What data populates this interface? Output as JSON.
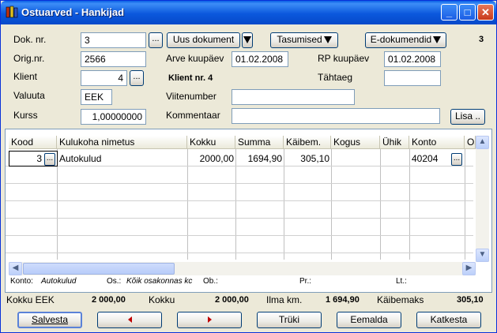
{
  "window": {
    "title": "Ostuarved - Hankijad",
    "buttons": {
      "minimize": "_",
      "maximize": "□",
      "close": "✕"
    }
  },
  "form": {
    "dok_nr_label": "Dok. nr.",
    "dok_nr_value": "3",
    "uus_dokument_label": "Uus dokument",
    "tasumised_label": "Tasumised",
    "edokumendid_label": "E-dokumendid",
    "record_count": "3",
    "orig_nr_label": "Orig.nr.",
    "orig_nr_value": "2566",
    "arve_kuupaev_label": "Arve kuupäev",
    "arve_kuupaev_value": "01.02.2008",
    "rp_kuupaev_label": "RP kuupäev",
    "rp_kuupaev_value": "01.02.2008",
    "klient_label": "Klient",
    "klient_value": "4",
    "klient_name": "Klient nr. 4",
    "tahtaeg_label": "Tähtaeg",
    "tahtaeg_value": "",
    "valuuta_label": "Valuuta",
    "valuuta_value": "EEK",
    "viitenumber_label": "Viitenumber",
    "viitenumber_value": "",
    "kurss_label": "Kurss",
    "kurss_value": "1,00000000",
    "kommentaar_label": "Kommentaar",
    "kommentaar_value": "",
    "lisa_label": "Lisa ..",
    "dots": "..."
  },
  "grid": {
    "columns": [
      "Kood",
      "Kulukoha nimetus",
      "Kokku",
      "Summa",
      "Käibem.",
      "Kogus",
      "Ühik",
      "Konto",
      "Os"
    ],
    "rows": [
      {
        "kood": "3",
        "nimetus": "Autokulud",
        "kokku": "2000,00",
        "summa": "1694,90",
        "kaibem": "305,10",
        "kogus": "",
        "uhik": "",
        "konto": "40204",
        "os": ""
      }
    ]
  },
  "info": {
    "konto_label": "Konto:",
    "konto_value": "Autokulud",
    "os_label": "Os.:",
    "os_value": "Kõik osakonnas kc",
    "ob_label": "Ob.:",
    "pr_label": "Pr.:",
    "lt_label": "Lt.:"
  },
  "totals": {
    "kokku_eek_label": "Kokku EEK",
    "kokku_eek_value": "2 000,00",
    "kokku_label": "Kokku",
    "kokku_value": "2 000,00",
    "ilma_km_label": "Ilma km.",
    "ilma_km_value": "1 694,90",
    "kaibemaks_label": "Käibemaks",
    "kaibemaks_value": "305,10"
  },
  "buttons": {
    "salvesta": "Salvesta",
    "truki": "Trüki",
    "eemalda": "Eemalda",
    "katkesta": "Katkesta"
  }
}
